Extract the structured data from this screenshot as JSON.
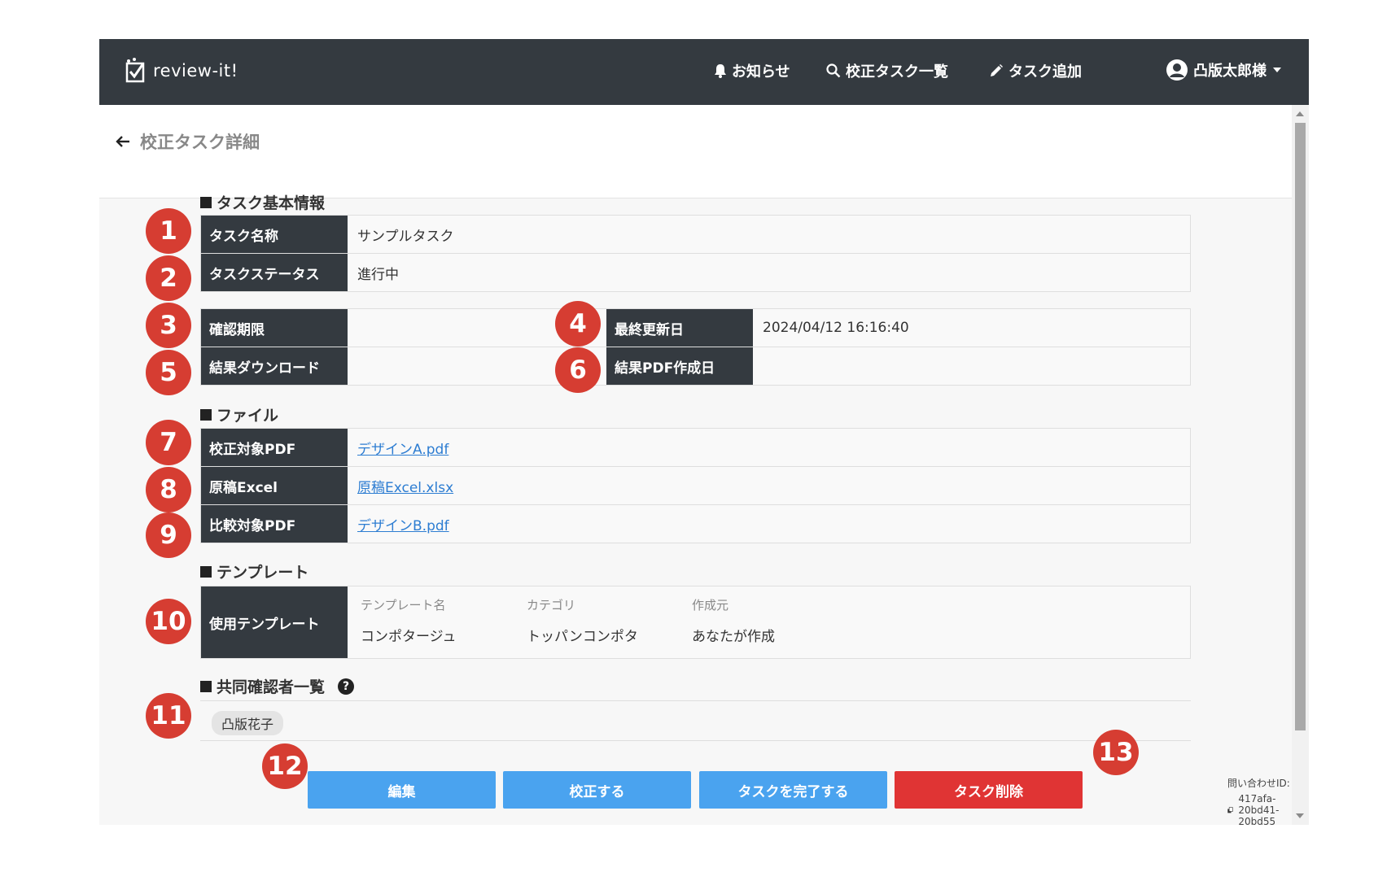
{
  "navbar": {
    "brand": "review-it!",
    "items": [
      {
        "label": "お知らせ",
        "icon": "bell-icon"
      },
      {
        "label": "校正タスク一覧",
        "icon": "search-icon"
      },
      {
        "label": "タスク追加",
        "icon": "pencil-icon"
      },
      {
        "label": "凸版太郎様",
        "icon": "user-icon"
      }
    ]
  },
  "page": {
    "title": "校正タスク詳細"
  },
  "basic": {
    "section_title": "タスク基本情報",
    "task_name_label": "タスク名称",
    "task_name": "サンプルタスク",
    "status_label": "タスクステータス",
    "status": "進行中",
    "deadline_label": "確認期限",
    "deadline": "",
    "updated_label": "最終更新日",
    "updated": "2024/04/12 16:16:40",
    "download_label": "結果ダウンロード",
    "download": "",
    "pdf_created_label": "結果PDF作成日",
    "pdf_created": ""
  },
  "files": {
    "section_title": "ファイル",
    "target_pdf_label": "校正対象PDF",
    "target_pdf": "デザインA.pdf",
    "excel_label": "原稿Excel",
    "excel": "原稿Excel.xlsx",
    "compare_pdf_label": "比較対象PDF",
    "compare_pdf": "デザインB.pdf"
  },
  "template": {
    "section_title": "テンプレート",
    "label": "使用テンプレート",
    "columns": [
      {
        "label": "テンプレート名",
        "value": "コンポタージュ"
      },
      {
        "label": "カテゴリ",
        "value": "トッパンコンポタ"
      },
      {
        "label": "作成元",
        "value": "あなたが作成"
      }
    ]
  },
  "reviewers": {
    "section_title": "共同確認者一覧",
    "help": "?",
    "list": [
      "凸版花子"
    ]
  },
  "buttons": {
    "edit": "編集",
    "proofread": "校正する",
    "complete": "タスクを完了する",
    "delete": "タスク削除"
  },
  "inquiry": {
    "label": "問い合わせID:",
    "id": "417afa-20bd41-20bd55"
  },
  "badges": [
    "1",
    "2",
    "3",
    "4",
    "5",
    "6",
    "7",
    "8",
    "9",
    "10",
    "11",
    "12",
    "13"
  ],
  "colors": {
    "navbar": "#343a40",
    "badge": "#d63d32",
    "primary_button": "#4aa3ef",
    "danger_button": "#e03434",
    "link": "#2d7dd2"
  }
}
